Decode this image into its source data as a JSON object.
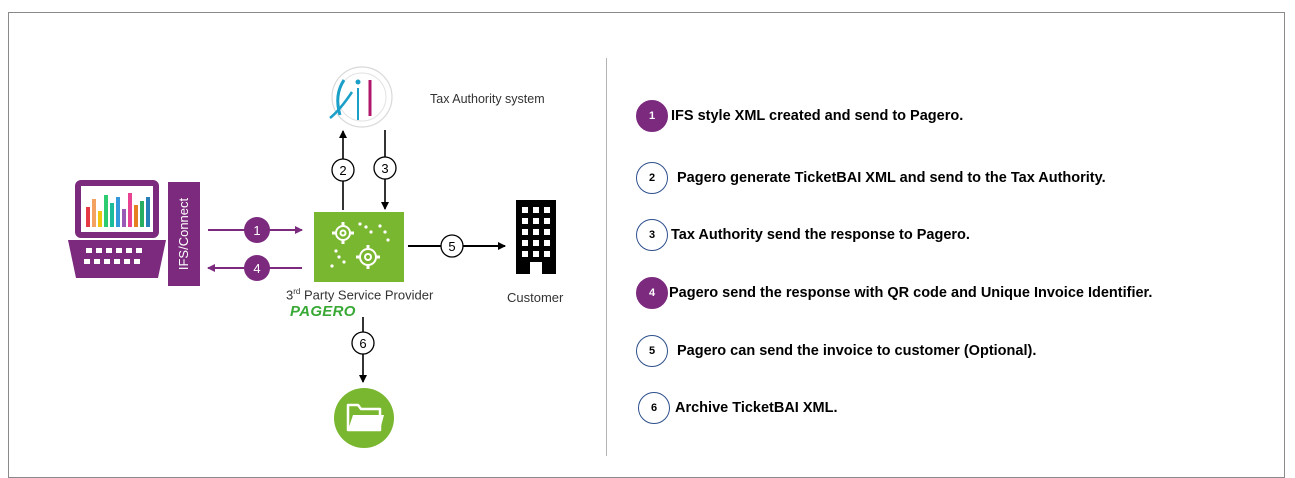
{
  "labels": {
    "tax_authority": "Tax Authority system",
    "connector": "IFS/Connect",
    "provider": "3rd Party Service Provider",
    "provider_sup": "rd",
    "provider_pre": "3",
    "provider_post": " Party Service Provider",
    "brand": "PAGERO",
    "customer": "Customer"
  },
  "flow_numbers": [
    "1",
    "2",
    "3",
    "4",
    "5",
    "6"
  ],
  "steps": [
    {
      "num": "1",
      "text": "IFS style XML created and send to Pagero.",
      "filled": true
    },
    {
      "num": "2",
      "text": "Pagero generate TicketBAI XML and send to the Tax Authority.",
      "filled": false
    },
    {
      "num": "3",
      "text": "Tax Authority send the response to Pagero.",
      "filled": false
    },
    {
      "num": "4",
      "text": "Pagero send the response with QR code and Unique Invoice Identifier.",
      "filled": true
    },
    {
      "num": "5",
      "text": "Pagero can send the invoice to customer (Optional).",
      "filled": false
    },
    {
      "num": "6",
      "text": "Archive TicketBAI XML.",
      "filled": false
    }
  ],
  "colors": {
    "purple": "#7b2a7e",
    "green": "#7ab730",
    "brand_green": "#39a935",
    "outline_blue": "#2d4f8c"
  },
  "icons": {
    "laptop": "laptop-chart-icon",
    "tax": "tax-authority-logo-icon",
    "service": "gears-icon",
    "customer": "building-icon",
    "archive": "folder-icon"
  }
}
